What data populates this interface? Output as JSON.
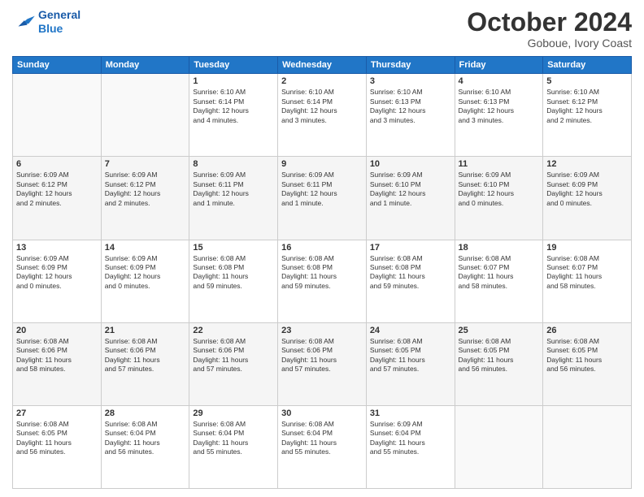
{
  "logo": {
    "line1": "General",
    "line2": "Blue"
  },
  "title": "October 2024",
  "location": "Goboue, Ivory Coast",
  "weekdays": [
    "Sunday",
    "Monday",
    "Tuesday",
    "Wednesday",
    "Thursday",
    "Friday",
    "Saturday"
  ],
  "weeks": [
    [
      {
        "day": "",
        "info": ""
      },
      {
        "day": "",
        "info": ""
      },
      {
        "day": "1",
        "info": "Sunrise: 6:10 AM\nSunset: 6:14 PM\nDaylight: 12 hours\nand 4 minutes."
      },
      {
        "day": "2",
        "info": "Sunrise: 6:10 AM\nSunset: 6:14 PM\nDaylight: 12 hours\nand 3 minutes."
      },
      {
        "day": "3",
        "info": "Sunrise: 6:10 AM\nSunset: 6:13 PM\nDaylight: 12 hours\nand 3 minutes."
      },
      {
        "day": "4",
        "info": "Sunrise: 6:10 AM\nSunset: 6:13 PM\nDaylight: 12 hours\nand 3 minutes."
      },
      {
        "day": "5",
        "info": "Sunrise: 6:10 AM\nSunset: 6:12 PM\nDaylight: 12 hours\nand 2 minutes."
      }
    ],
    [
      {
        "day": "6",
        "info": "Sunrise: 6:09 AM\nSunset: 6:12 PM\nDaylight: 12 hours\nand 2 minutes."
      },
      {
        "day": "7",
        "info": "Sunrise: 6:09 AM\nSunset: 6:12 PM\nDaylight: 12 hours\nand 2 minutes."
      },
      {
        "day": "8",
        "info": "Sunrise: 6:09 AM\nSunset: 6:11 PM\nDaylight: 12 hours\nand 1 minute."
      },
      {
        "day": "9",
        "info": "Sunrise: 6:09 AM\nSunset: 6:11 PM\nDaylight: 12 hours\nand 1 minute."
      },
      {
        "day": "10",
        "info": "Sunrise: 6:09 AM\nSunset: 6:10 PM\nDaylight: 12 hours\nand 1 minute."
      },
      {
        "day": "11",
        "info": "Sunrise: 6:09 AM\nSunset: 6:10 PM\nDaylight: 12 hours\nand 0 minutes."
      },
      {
        "day": "12",
        "info": "Sunrise: 6:09 AM\nSunset: 6:09 PM\nDaylight: 12 hours\nand 0 minutes."
      }
    ],
    [
      {
        "day": "13",
        "info": "Sunrise: 6:09 AM\nSunset: 6:09 PM\nDaylight: 12 hours\nand 0 minutes."
      },
      {
        "day": "14",
        "info": "Sunrise: 6:09 AM\nSunset: 6:09 PM\nDaylight: 12 hours\nand 0 minutes."
      },
      {
        "day": "15",
        "info": "Sunrise: 6:08 AM\nSunset: 6:08 PM\nDaylight: 11 hours\nand 59 minutes."
      },
      {
        "day": "16",
        "info": "Sunrise: 6:08 AM\nSunset: 6:08 PM\nDaylight: 11 hours\nand 59 minutes."
      },
      {
        "day": "17",
        "info": "Sunrise: 6:08 AM\nSunset: 6:08 PM\nDaylight: 11 hours\nand 59 minutes."
      },
      {
        "day": "18",
        "info": "Sunrise: 6:08 AM\nSunset: 6:07 PM\nDaylight: 11 hours\nand 58 minutes."
      },
      {
        "day": "19",
        "info": "Sunrise: 6:08 AM\nSunset: 6:07 PM\nDaylight: 11 hours\nand 58 minutes."
      }
    ],
    [
      {
        "day": "20",
        "info": "Sunrise: 6:08 AM\nSunset: 6:06 PM\nDaylight: 11 hours\nand 58 minutes."
      },
      {
        "day": "21",
        "info": "Sunrise: 6:08 AM\nSunset: 6:06 PM\nDaylight: 11 hours\nand 57 minutes."
      },
      {
        "day": "22",
        "info": "Sunrise: 6:08 AM\nSunset: 6:06 PM\nDaylight: 11 hours\nand 57 minutes."
      },
      {
        "day": "23",
        "info": "Sunrise: 6:08 AM\nSunset: 6:06 PM\nDaylight: 11 hours\nand 57 minutes."
      },
      {
        "day": "24",
        "info": "Sunrise: 6:08 AM\nSunset: 6:05 PM\nDaylight: 11 hours\nand 57 minutes."
      },
      {
        "day": "25",
        "info": "Sunrise: 6:08 AM\nSunset: 6:05 PM\nDaylight: 11 hours\nand 56 minutes."
      },
      {
        "day": "26",
        "info": "Sunrise: 6:08 AM\nSunset: 6:05 PM\nDaylight: 11 hours\nand 56 minutes."
      }
    ],
    [
      {
        "day": "27",
        "info": "Sunrise: 6:08 AM\nSunset: 6:05 PM\nDaylight: 11 hours\nand 56 minutes."
      },
      {
        "day": "28",
        "info": "Sunrise: 6:08 AM\nSunset: 6:04 PM\nDaylight: 11 hours\nand 56 minutes."
      },
      {
        "day": "29",
        "info": "Sunrise: 6:08 AM\nSunset: 6:04 PM\nDaylight: 11 hours\nand 55 minutes."
      },
      {
        "day": "30",
        "info": "Sunrise: 6:08 AM\nSunset: 6:04 PM\nDaylight: 11 hours\nand 55 minutes."
      },
      {
        "day": "31",
        "info": "Sunrise: 6:09 AM\nSunset: 6:04 PM\nDaylight: 11 hours\nand 55 minutes."
      },
      {
        "day": "",
        "info": ""
      },
      {
        "day": "",
        "info": ""
      }
    ]
  ]
}
